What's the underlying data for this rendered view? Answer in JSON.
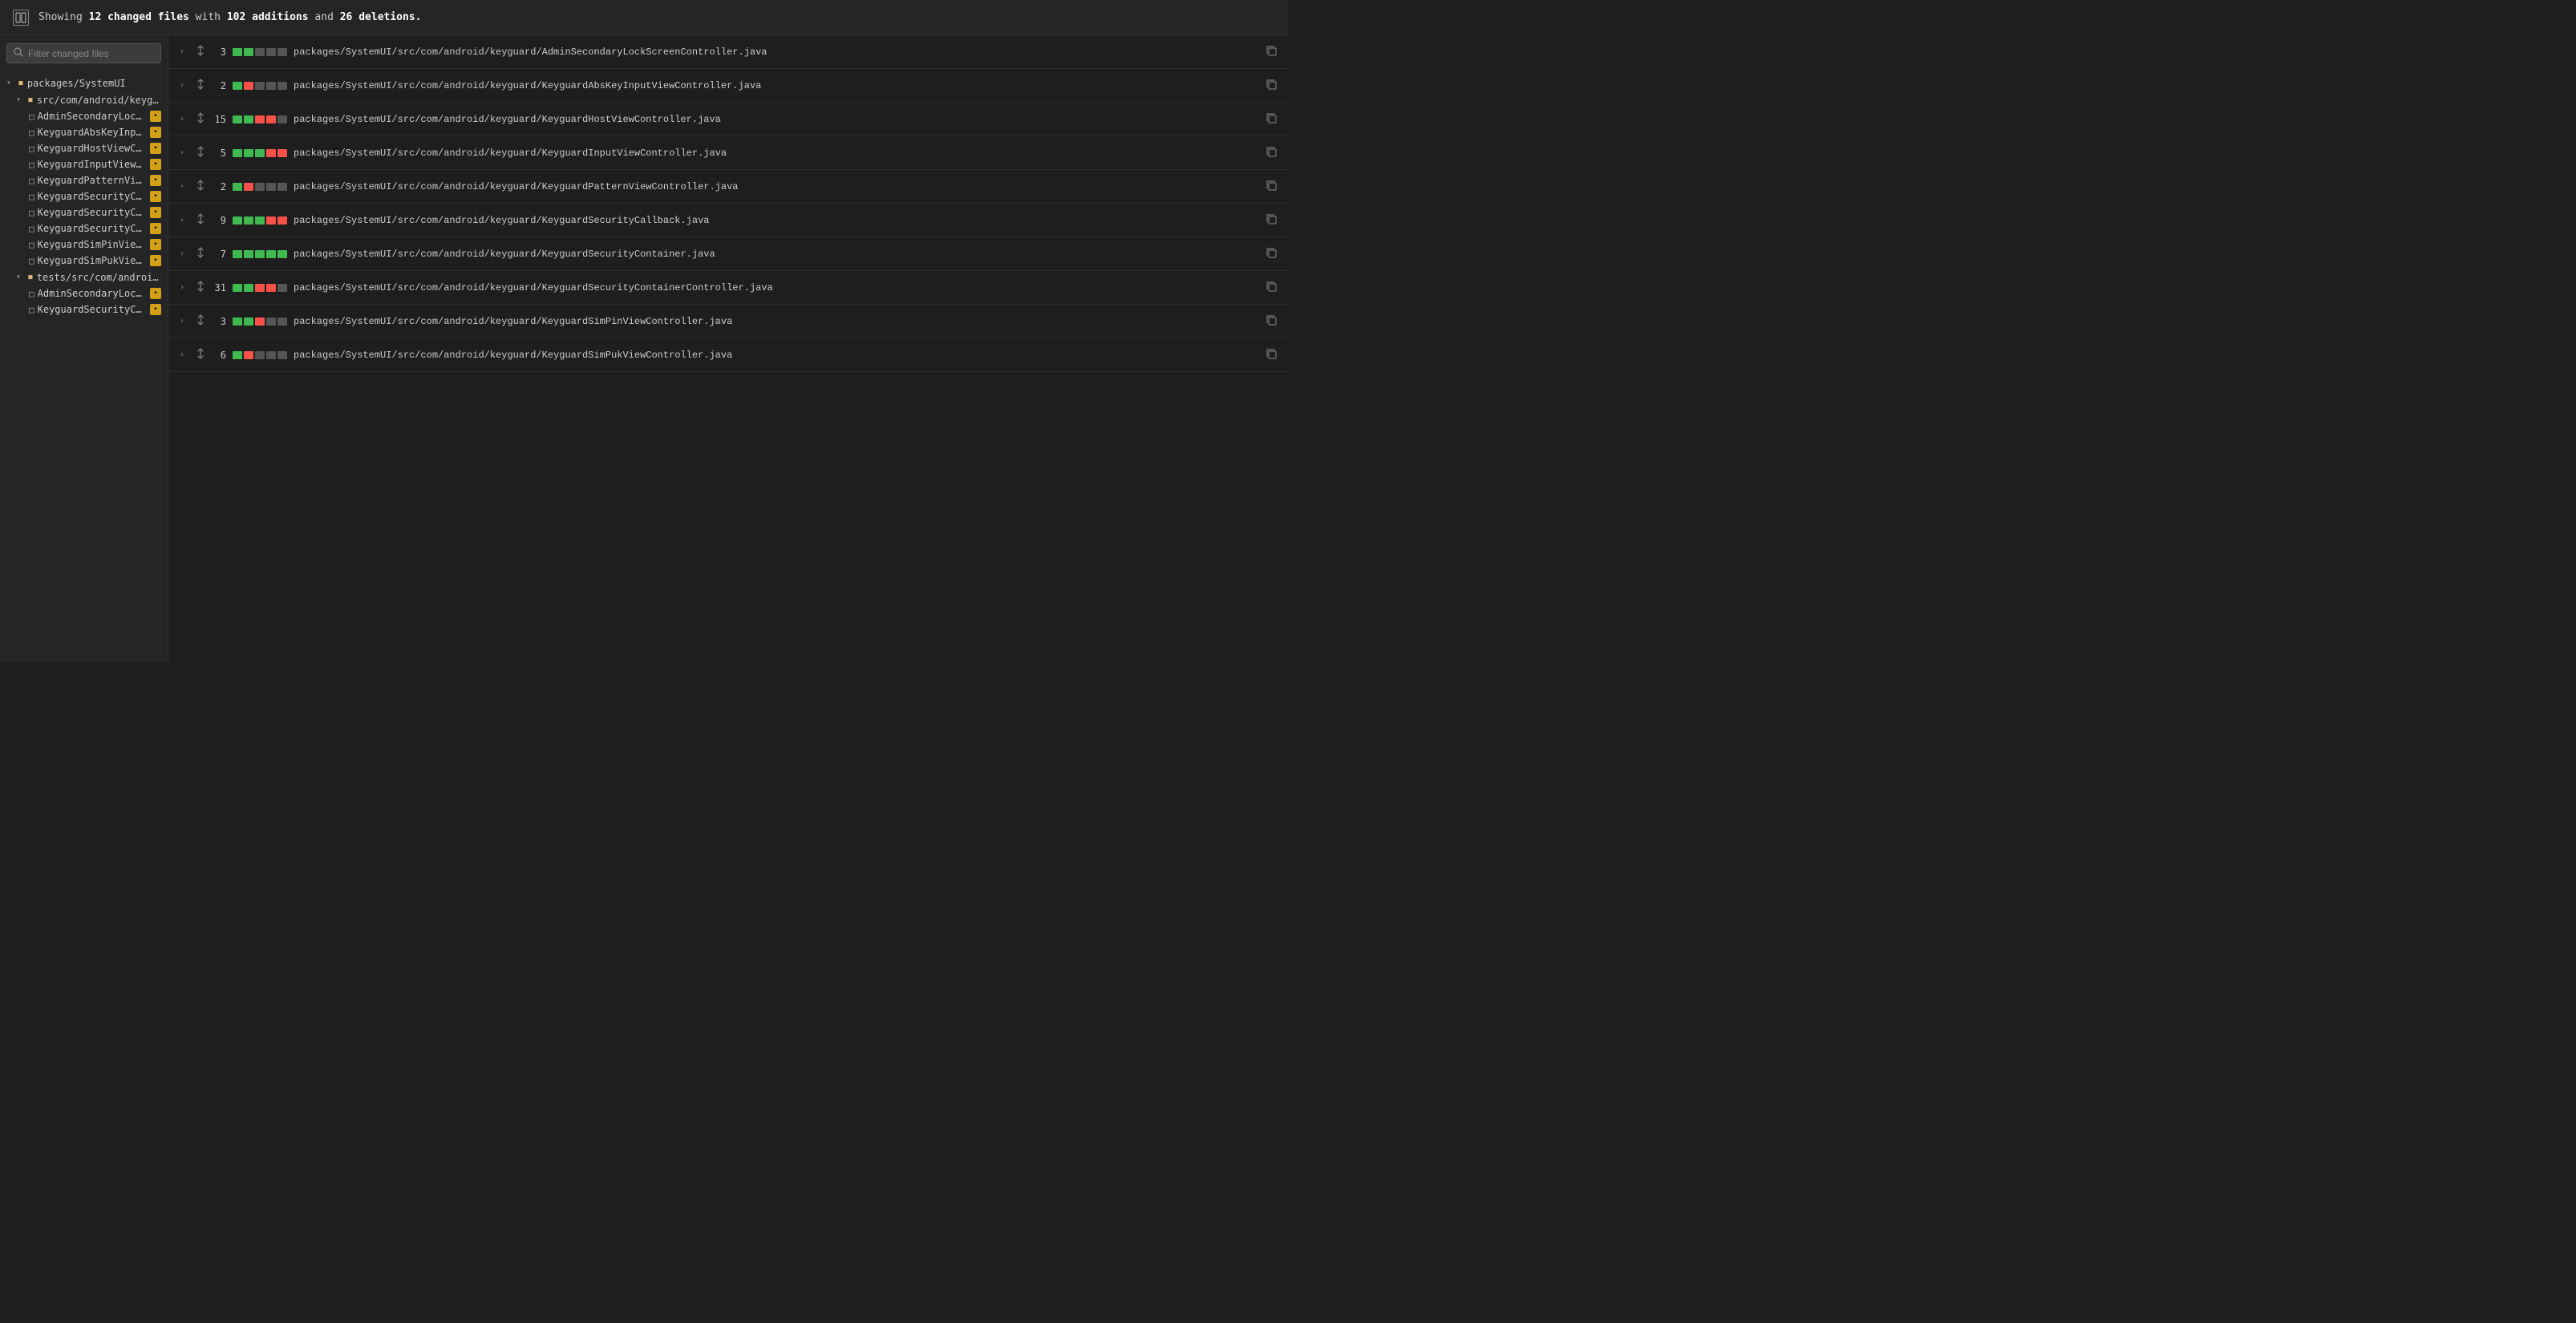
{
  "header": {
    "changed_count": "12",
    "additions": "102",
    "deletions": "26",
    "summary_text": "Showing",
    "changed_label": "changed files",
    "with_text": "with",
    "additions_label": "additions",
    "and_text": "and",
    "deletions_label": "deletions"
  },
  "sidebar": {
    "search_placeholder": "Filter changed files",
    "tree": [
      {
        "type": "folder",
        "label": "packages/SystemUI",
        "indent": 0,
        "expanded": true
      },
      {
        "type": "folder",
        "label": "src/com/android/keyguard",
        "indent": 1,
        "expanded": true
      },
      {
        "type": "file",
        "label": "AdminSecondaryLockScr...",
        "indent": 2,
        "badge": true
      },
      {
        "type": "file",
        "label": "KeyguardAbsKeyInputVie...",
        "indent": 2,
        "badge": true
      },
      {
        "type": "file",
        "label": "KeyguardHostViewContr...",
        "indent": 2,
        "badge": true
      },
      {
        "type": "file",
        "label": "KeyguardInputViewContr...",
        "indent": 2,
        "badge": true
      },
      {
        "type": "file",
        "label": "KeyguardPatternViewCon...",
        "indent": 2,
        "badge": true
      },
      {
        "type": "file",
        "label": "KeyguardSecurityCallbac...",
        "indent": 2,
        "badge": true
      },
      {
        "type": "file",
        "label": "KeyguardSecurityContain...",
        "indent": 2,
        "badge": true
      },
      {
        "type": "file",
        "label": "KeyguardSecurityContain...",
        "indent": 2,
        "badge": true
      },
      {
        "type": "file",
        "label": "KeyguardSimPinViewCon...",
        "indent": 2,
        "badge": true
      },
      {
        "type": "file",
        "label": "KeyguardSimPukViewCo...",
        "indent": 2,
        "badge": true
      },
      {
        "type": "folder",
        "label": "tests/src/com/android/keyguard",
        "indent": 1,
        "expanded": true
      },
      {
        "type": "file",
        "label": "AdminSecondaryLockScr...",
        "indent": 2,
        "badge": true
      },
      {
        "type": "file",
        "label": "KeyguardSecurityContain...",
        "indent": 2,
        "badge": true
      }
    ]
  },
  "file_list": {
    "rows": [
      {
        "count": "3",
        "path": "packages/SystemUI/src/com/android/keyguard/AdminSecondaryLockScreenController.java",
        "segments": [
          "green",
          "green",
          "gray",
          "gray",
          "gray"
        ]
      },
      {
        "count": "2",
        "path": "packages/SystemUI/src/com/android/keyguard/KeyguardAbsKeyInputViewController.java",
        "segments": [
          "green",
          "red",
          "gray",
          "gray",
          "gray"
        ]
      },
      {
        "count": "15",
        "path": "packages/SystemUI/src/com/android/keyguard/KeyguardHostViewController.java",
        "segments": [
          "green",
          "green",
          "red",
          "red",
          "gray"
        ]
      },
      {
        "count": "5",
        "path": "packages/SystemUI/src/com/android/keyguard/KeyguardInputViewController.java",
        "segments": [
          "green",
          "green",
          "green",
          "red",
          "red"
        ]
      },
      {
        "count": "2",
        "path": "packages/SystemUI/src/com/android/keyguard/KeyguardPatternViewController.java",
        "segments": [
          "green",
          "red",
          "gray",
          "gray",
          "gray"
        ]
      },
      {
        "count": "9",
        "path": "packages/SystemUI/src/com/android/keyguard/KeyguardSecurityCallback.java",
        "segments": [
          "green",
          "green",
          "green",
          "red",
          "red"
        ]
      },
      {
        "count": "7",
        "path": "packages/SystemUI/src/com/android/keyguard/KeyguardSecurityContainer.java",
        "segments": [
          "green",
          "green",
          "green",
          "green",
          "green"
        ]
      },
      {
        "count": "31",
        "path": "packages/SystemUI/src/com/android/keyguard/KeyguardSecurityContainerController.java",
        "segments": [
          "green",
          "green",
          "red",
          "red",
          "gray"
        ]
      },
      {
        "count": "3",
        "path": "packages/SystemUI/src/com/android/keyguard/KeyguardSimPinViewController.java",
        "segments": [
          "green",
          "green",
          "red",
          "gray",
          "gray"
        ]
      },
      {
        "count": "6",
        "path": "packages/SystemUI/src/com/android/keyguard/KeyguardSimPukViewController.java",
        "segments": [
          "green",
          "red",
          "gray",
          "gray",
          "gray"
        ]
      }
    ]
  },
  "icons": {
    "toggle": "⊡",
    "search": "🔍",
    "chevron_down": "▾",
    "chevron_right": "▸",
    "folder": "▪",
    "file": "□",
    "expand": "›",
    "diff_arrows": "⇅",
    "copy": "⧉"
  }
}
